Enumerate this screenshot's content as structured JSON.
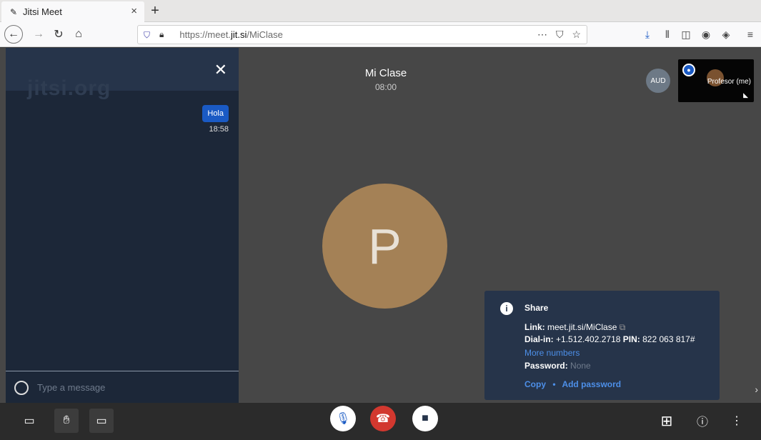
{
  "browser": {
    "tab_title": "Jitsi Meet",
    "url_prefix": "https://meet.",
    "url_domain": "jit.si",
    "url_path": "/MiClase"
  },
  "chat": {
    "watermark": "jitsi.org",
    "message_text": "Hola",
    "message_time": "18:58",
    "input_placeholder": "Type a message"
  },
  "conference": {
    "title": "Mi Clase",
    "time": "08:00",
    "avatar_letter": "P"
  },
  "filmstrip": {
    "aud_label": "AUD",
    "local_name": "Profesor (me)"
  },
  "info": {
    "header": "Share",
    "link_label": "Link:",
    "link_value": "meet.jit.si/MiClase",
    "dialin_label": "Dial-in:",
    "dialin_value": "+1.512.402.2718",
    "pin_label": "PIN:",
    "pin_value": "822 063 817#",
    "more_numbers": "More numbers",
    "password_label": "Password:",
    "password_value": "None",
    "copy": "Copy",
    "separator": "•",
    "add_password": "Add password"
  },
  "colors": {
    "chat_bg": "#1c2738",
    "accent": "#1a5ac4",
    "hangup": "#d2382f",
    "avatar": "#a48156"
  }
}
